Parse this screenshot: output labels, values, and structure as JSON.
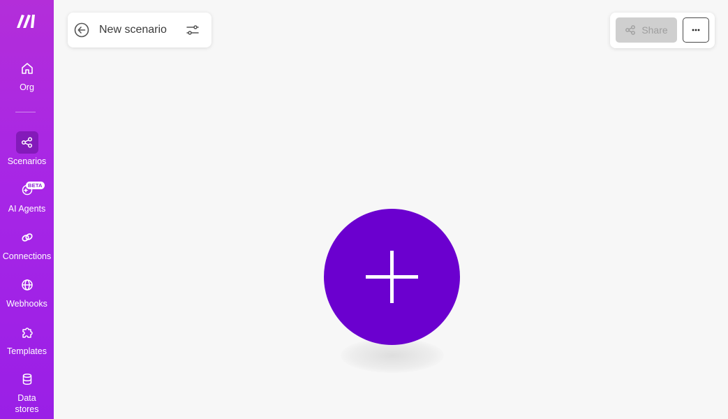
{
  "app": {
    "brand_color": "#a726e6",
    "accent": "#6b00cf"
  },
  "sidebar": {
    "items": [
      {
        "label": "Org",
        "icon": "home-icon"
      },
      {
        "label": "Scenarios",
        "icon": "share-nodes-icon",
        "active": true
      },
      {
        "label": "AI Agents",
        "icon": "ai-agent-icon",
        "badge": "BETA"
      },
      {
        "label": "Connections",
        "icon": "link-icon"
      },
      {
        "label": "Webhooks",
        "icon": "globe-icon"
      },
      {
        "label": "Templates",
        "icon": "puzzle-icon"
      },
      {
        "label": "Data\nstores",
        "icon": "database-icon"
      }
    ]
  },
  "header": {
    "title": "New scenario",
    "back_icon": "back-arrow-icon",
    "settings_icon": "sliders-icon"
  },
  "actions": {
    "share_label": "Share",
    "share_icon": "share-nodes-icon",
    "more_icon": "ellipsis-icon"
  },
  "canvas": {
    "add_button_icon": "plus-icon"
  }
}
